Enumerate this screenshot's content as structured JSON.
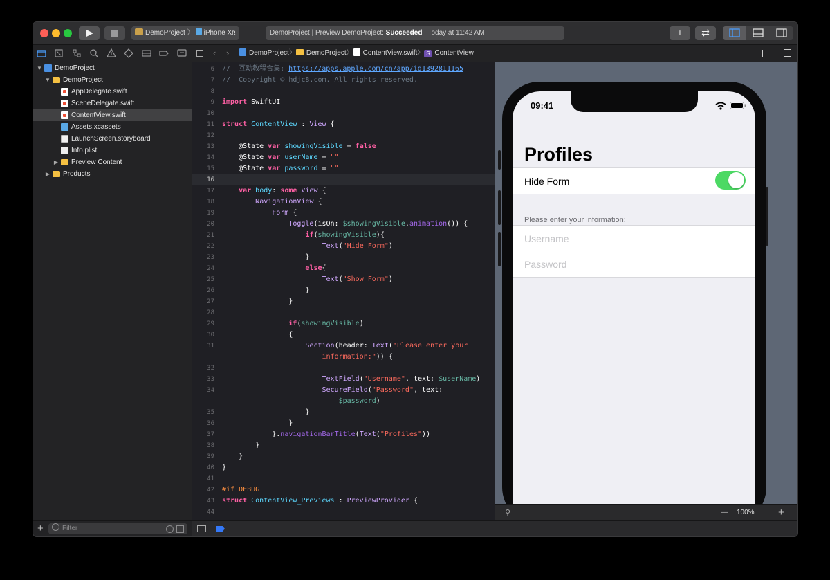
{
  "toolbar": {
    "scheme_project": "DemoProject",
    "scheme_device": "iPhone Xʀ",
    "status_prefix": "DemoProject | Preview DemoProject: ",
    "status_result": "Succeeded",
    "status_suffix": " | Today at 11:42 AM",
    "add_label": "+",
    "swap_label": "⇄"
  },
  "navigator": {
    "items": [
      {
        "label": "DemoProject",
        "icon": "project-icon",
        "disclosure": "▼"
      },
      {
        "label": "DemoProject",
        "icon": "folder-icon",
        "disclosure": "▼"
      },
      {
        "label": "AppDelegate.swift",
        "icon": "swift-file-icon"
      },
      {
        "label": "SceneDelegate.swift",
        "icon": "swift-file-icon"
      },
      {
        "label": "ContentView.swift",
        "icon": "swift-file-icon"
      },
      {
        "label": "Assets.xcassets",
        "icon": "asset-catalog-icon"
      },
      {
        "label": "LaunchScreen.storyboard",
        "icon": "storyboard-icon"
      },
      {
        "label": "Info.plist",
        "icon": "plist-icon"
      },
      {
        "label": "Preview Content",
        "icon": "folder-icon",
        "disclosure": "▶"
      },
      {
        "label": "Products",
        "icon": "folder-icon",
        "disclosure": "▶"
      }
    ],
    "filter_placeholder": "Filter",
    "add_label": "+"
  },
  "jumpbar": {
    "crumbs": [
      "DemoProject",
      "DemoProject",
      "ContentView.swift",
      "ContentView"
    ],
    "separator": "〉"
  },
  "editor": {
    "lines": {
      "n6": "6",
      "t6_a": "//  互动教程合集: ",
      "t6_b": "https://apps.apple.com/cn/app/id1392811165",
      "n7": "7",
      "t7": "//  Copyright © hdjc8.com. All rights reserved.",
      "n8": "8",
      "n9": "9",
      "t9_a": "import",
      "t9_b": " SwiftUI",
      "n10": "10",
      "n11": "11",
      "t11_a": "struct",
      "t11_b": " ContentView",
      "t11_c": " : ",
      "t11_d": "View",
      "t11_e": " {",
      "n12": "12",
      "n13": "13",
      "t13_a": "    @State ",
      "t13_b": "var",
      "t13_c": " showingVisible",
      "t13_d": " = ",
      "t13_e": "false",
      "n14": "14",
      "t14_a": "    @State ",
      "t14_b": "var",
      "t14_c": " userName",
      "t14_d": " = ",
      "t14_e": "\"\"",
      "n15": "15",
      "t15_a": "    @State ",
      "t15_b": "var",
      "t15_c": " password",
      "t15_d": " = ",
      "t15_e": "\"\"",
      "n16": "16",
      "n17": "17",
      "t17_a": "    ",
      "t17_b": "var",
      "t17_c": " body",
      "t17_d": ": ",
      "t17_e": "some",
      "t17_f": " View",
      "t17_g": " {",
      "n18": "18",
      "t18_a": "        ",
      "t18_b": "NavigationView",
      "t18_c": " {",
      "n19": "19",
      "t19_a": "            ",
      "t19_b": "Form",
      "t19_c": " {",
      "n20": "20",
      "t20_a": "                ",
      "t20_b": "Toggle",
      "t20_c": "(isOn: ",
      "t20_d": "$showingVisible",
      "t20_e": ".",
      "t20_f": "animation",
      "t20_g": "()) {",
      "n21": "21",
      "t21_a": "                    ",
      "t21_b": "if",
      "t21_c": "(",
      "t21_d": "showingVisible",
      "t21_e": "){",
      "n22": "22",
      "t22_a": "                        ",
      "t22_b": "Text",
      "t22_c": "(",
      "t22_d": "\"Hide Form\"",
      "t22_e": ")",
      "n23": "23",
      "t23": "                    }",
      "n24": "24",
      "t24_a": "                    ",
      "t24_b": "else",
      "t24_c": "{",
      "n25": "25",
      "t25_a": "                        ",
      "t25_b": "Text",
      "t25_c": "(",
      "t25_d": "\"Show Form\"",
      "t25_e": ")",
      "n26": "26",
      "t26": "                    }",
      "n27": "27",
      "t27": "                }",
      "n28": "28",
      "n29": "29",
      "t29_a": "                ",
      "t29_b": "if",
      "t29_c": "(",
      "t29_d": "showingVisible",
      "t29_e": ")",
      "n30": "30",
      "t30": "                {",
      "n31": "31",
      "t31_a": "                    ",
      "t31_b": "Section",
      "t31_c": "(header: ",
      "t31_d": "Text",
      "t31_e": "(",
      "t31_f": "\"Please enter your",
      "t31w_a": "                        ",
      "t31w_b": "information:\"",
      "t31w_c": ")) {",
      "n32": "32",
      "n33": "33",
      "t33_a": "                        ",
      "t33_b": "TextField",
      "t33_c": "(",
      "t33_d": "\"Username\"",
      "t33_e": ", text: ",
      "t33_f": "$userName",
      "t33_g": ")",
      "n34": "34",
      "t34_a": "                        ",
      "t34_b": "SecureField",
      "t34_c": "(",
      "t34_d": "\"Password\"",
      "t34_e": ", text:",
      "t34w_a": "                            ",
      "t34w_b": "$password",
      "t34w_c": ")",
      "n35": "35",
      "t35": "                    }",
      "n36": "36",
      "t36": "                }",
      "n37": "37",
      "t37_a": "            }.",
      "t37_b": "navigationBarTitle",
      "t37_c": "(",
      "t37_d": "Text",
      "t37_e": "(",
      "t37_f": "\"Profiles\"",
      "t37_g": "))",
      "n38": "38",
      "t38": "        }",
      "n39": "39",
      "t39": "    }",
      "n40": "40",
      "t40": "}",
      "n41": "41",
      "n42": "42",
      "t42": "#if DEBUG",
      "n43": "43",
      "t43_a": "struct",
      "t43_b": " ContentView_Previews",
      "t43_c": " : ",
      "t43_d": "PreviewProvider",
      "t43_e": " {",
      "n44": "44"
    }
  },
  "preview": {
    "time": "09:41",
    "nav_title": "Profiles",
    "toggle_label": "Hide Form",
    "toggle_on": true,
    "section_header": "Please enter your information:",
    "username_placeholder": "Username",
    "password_placeholder": "Password",
    "zoom": "100%",
    "zoom_minus": "—",
    "zoom_plus": "+"
  },
  "colors": {
    "accent": "#4cd964",
    "keyword": "#fc5fa3",
    "string": "#fc6a5d",
    "type": "#d0a8ff"
  }
}
